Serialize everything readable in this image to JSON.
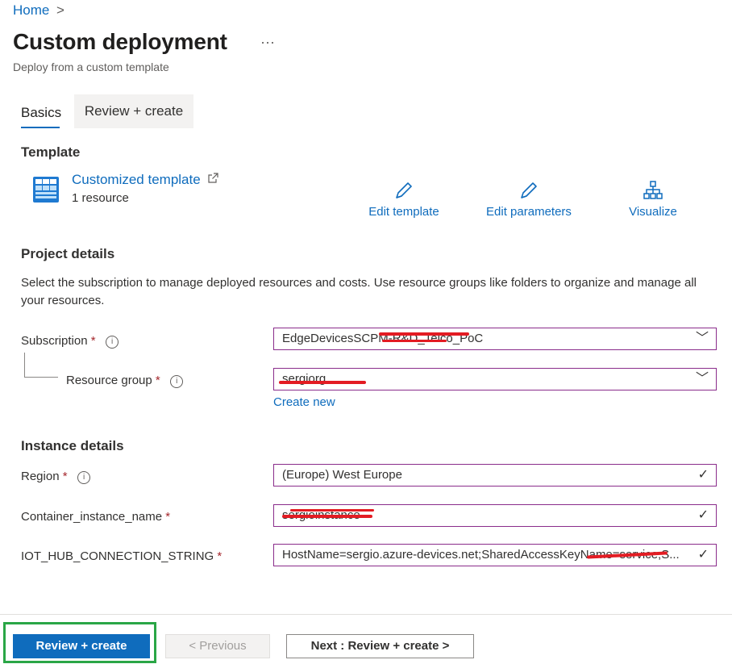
{
  "breadcrumb": {
    "home": "Home",
    "separator": ">"
  },
  "page": {
    "title": "Custom deployment",
    "more": "···",
    "subtitle": "Deploy from a custom template"
  },
  "tabs": [
    {
      "label": "Basics",
      "active": true
    },
    {
      "label": "Review + create",
      "active": false
    }
  ],
  "template": {
    "heading": "Template",
    "link": "Customized template",
    "external_icon": "external-link-icon",
    "resource_count": "1 resource",
    "actions": [
      {
        "label": "Edit template",
        "icon": "pencil-icon"
      },
      {
        "label": "Edit parameters",
        "icon": "pencil-icon"
      },
      {
        "label": "Visualize",
        "icon": "hierarchy-icon"
      }
    ]
  },
  "project": {
    "heading": "Project details",
    "description": "Select the subscription to manage deployed resources and costs. Use resource groups like folders to organize and manage all your resources.",
    "subscription": {
      "label": "Subscription",
      "value": "EdgeDevicesSCPM-R&D_Telco_PoC"
    },
    "resource_group": {
      "label": "Resource group",
      "value": "sergiorg",
      "create_new": "Create new"
    }
  },
  "instance": {
    "heading": "Instance details",
    "region": {
      "label": "Region",
      "value": "(Europe) West Europe"
    },
    "container_name": {
      "label": "Container_instance_name",
      "value": "sergioinstance"
    },
    "iot_conn": {
      "label": "IOT_HUB_CONNECTION_STRING",
      "value": "HostName=sergio.azure-devices.net;SharedAccessKeyName=service;S..."
    }
  },
  "common": {
    "required": "*",
    "info": "i",
    "chevron": "﹀",
    "check": "✓"
  },
  "footer": {
    "review_create": "Review + create",
    "previous": "< Previous",
    "next": "Next : Review + create >"
  },
  "colors": {
    "accent": "#0f6cbd",
    "field_border": "#8a2c8b",
    "highlight": "#2aa646",
    "redaction": "#e31c23"
  }
}
